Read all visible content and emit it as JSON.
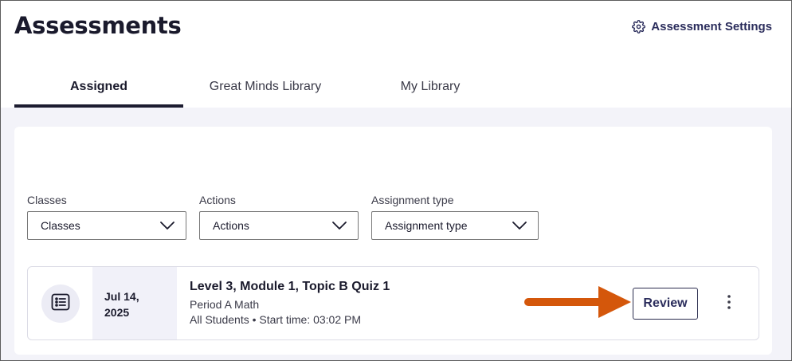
{
  "page": {
    "title": "Assessments",
    "settings_label": "Assessment Settings"
  },
  "tabs": [
    {
      "label": "Assigned",
      "active": true
    },
    {
      "label": "Great Minds Library",
      "active": false
    },
    {
      "label": "My Library",
      "active": false
    }
  ],
  "filters": [
    {
      "label": "Classes",
      "value": "Classes"
    },
    {
      "label": "Actions",
      "value": "Actions"
    },
    {
      "label": "Assignment type",
      "value": "Assignment type"
    }
  ],
  "assignment": {
    "date_line1": "Jul 14,",
    "date_line2": "2025",
    "title": "Level 3, Module 1, Topic B Quiz 1",
    "class_name": "Period A Math",
    "details": "All Students • Start time: 03:02 PM",
    "review_label": "Review"
  },
  "icons": {
    "settings": "gear-icon",
    "chevron": "chevron-down-icon",
    "assignment": "list-icon",
    "more": "more-vertical-icon",
    "annotation": "arrow-right-icon"
  },
  "colors": {
    "accent": "#2b2d5c",
    "arrow": "#d4570b",
    "content_bg": "#f3f3f9",
    "active_tab_underline": "#1c1c30"
  }
}
